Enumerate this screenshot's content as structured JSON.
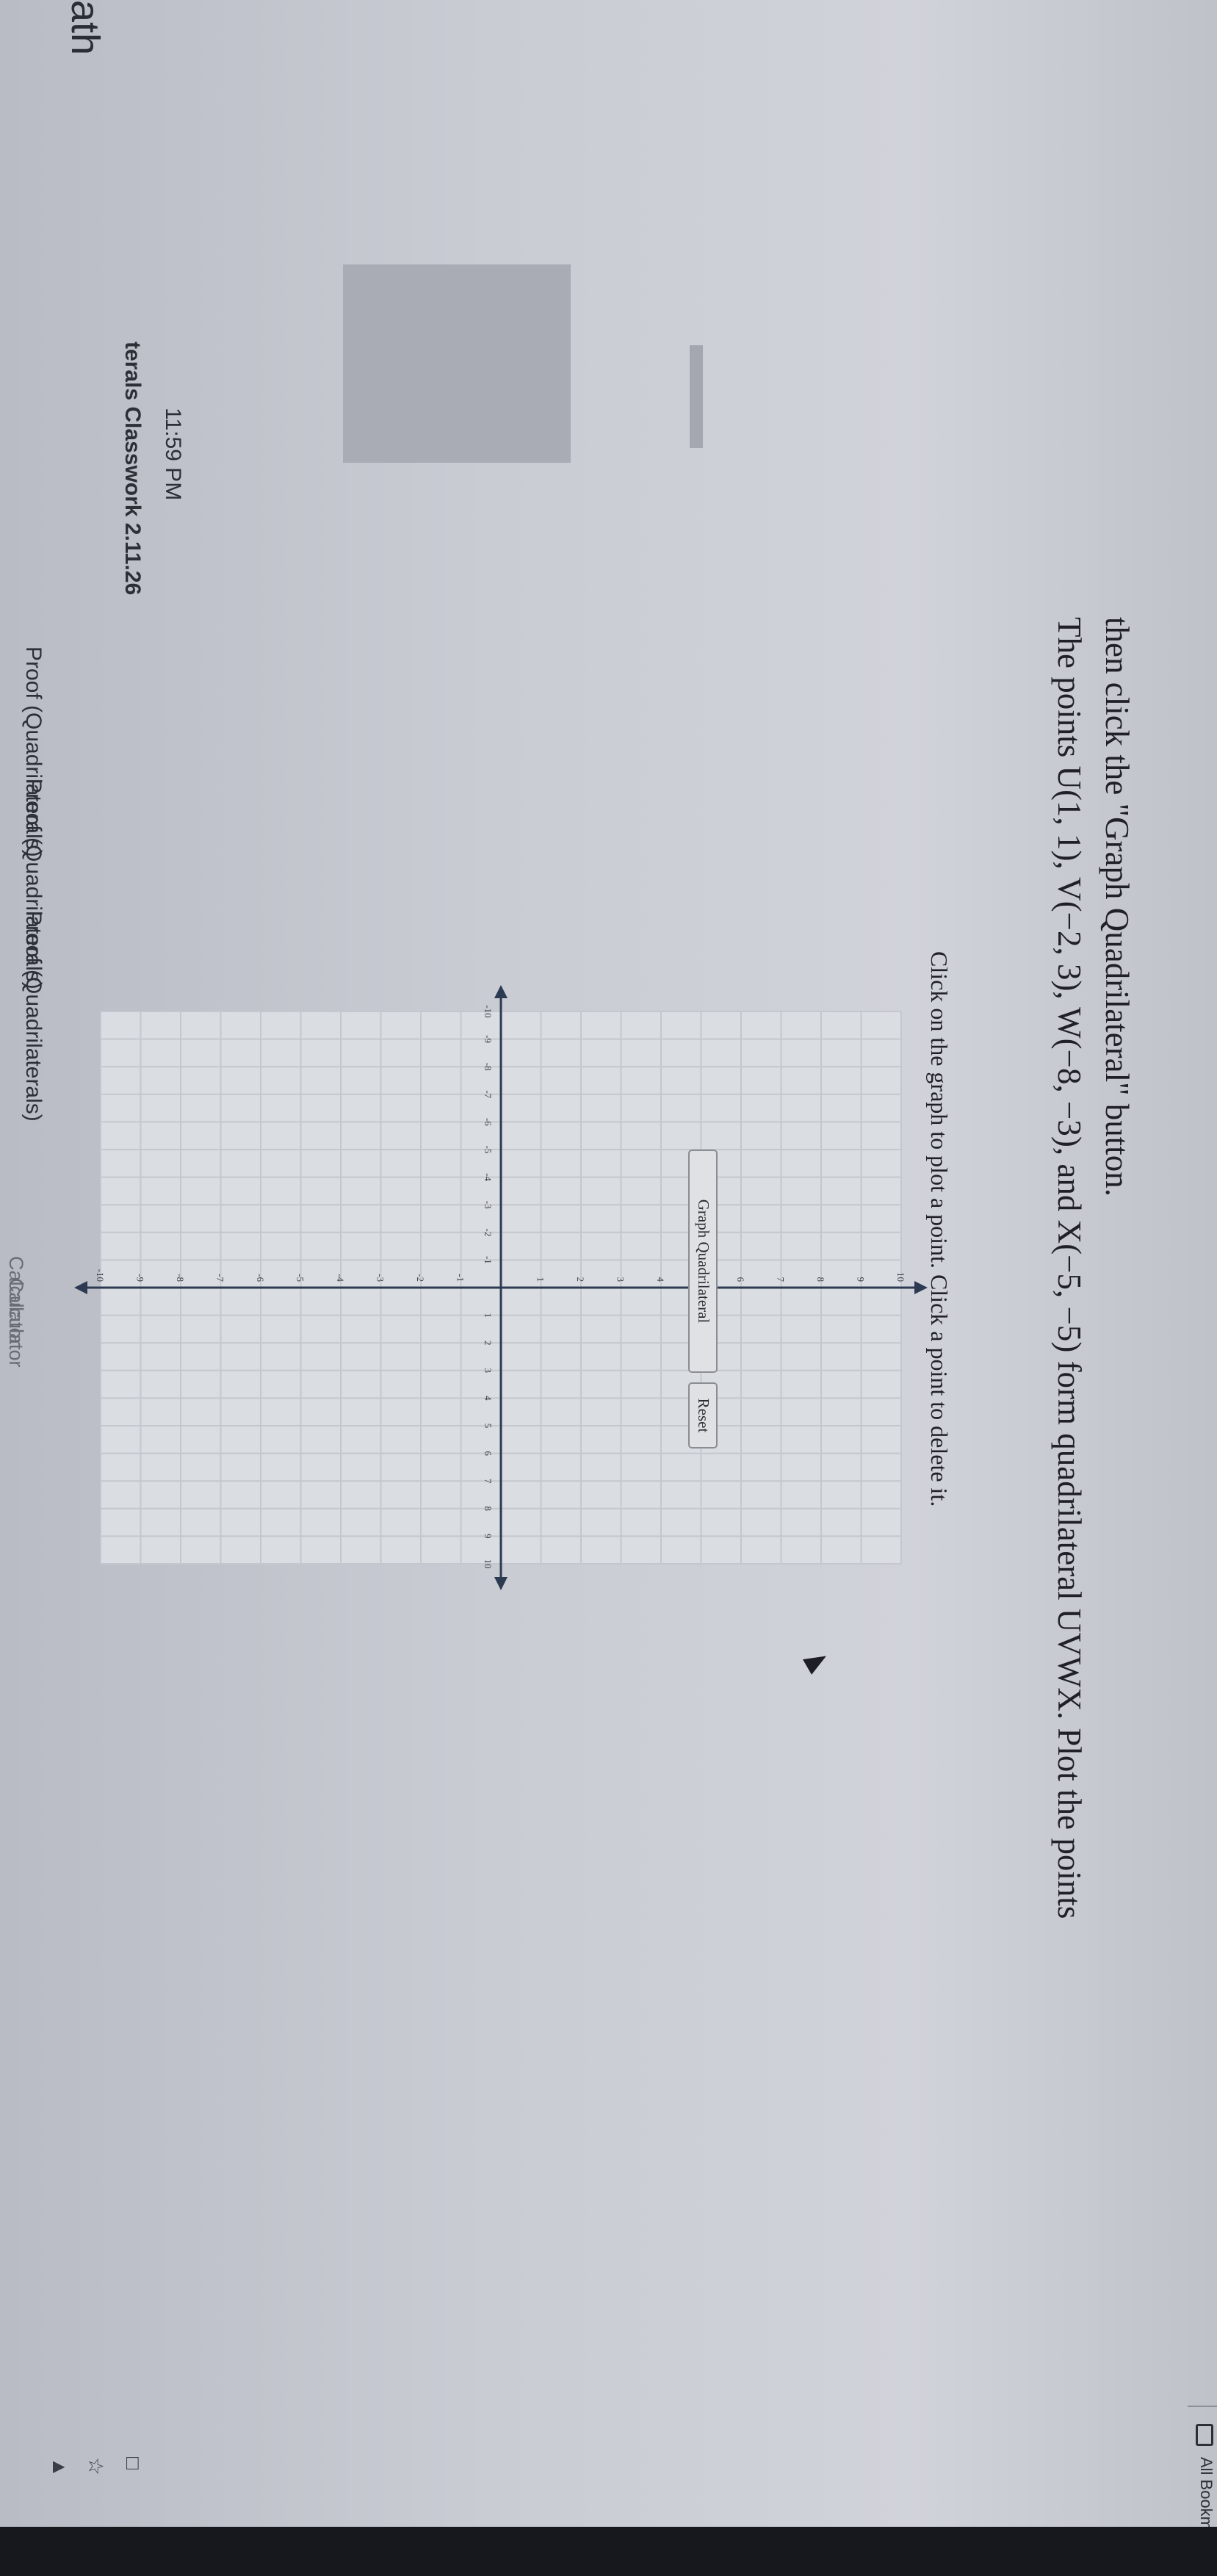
{
  "app": {
    "header": "ath"
  },
  "sidebar": {
    "assignment_title": "terals Classwork 2.11.26",
    "due_time": "11:59 PM",
    "items": [
      {
        "label": "Proof (Quadrilaterals)"
      },
      {
        "label": "Proof (Quadrilaterals)"
      },
      {
        "label": "Proof (Quadrilaterals)"
      }
    ],
    "tools": [
      {
        "label": "Calculator"
      },
      {
        "label": "Calculator"
      }
    ]
  },
  "browser": {
    "bookmarks_label": "All Bookmar"
  },
  "problem": {
    "line1": "The points U(1, 1), V(−2, 3), W(−8, −3), and X(−5, −5) form quadrilateral UVWX. Plot the points",
    "line2": "then click the \"Graph Quadrilateral\" button.",
    "instructions": "Click on the graph to plot a point. Click a point to delete it."
  },
  "graph": {
    "xlim": [
      -10,
      10
    ],
    "ylim": [
      -10,
      10
    ],
    "grid": true,
    "x_ticks": [
      -10,
      -9,
      -8,
      -7,
      -6,
      -5,
      -4,
      -3,
      -2,
      -1,
      1,
      2,
      3,
      4,
      5,
      6,
      7,
      8,
      9,
      10
    ],
    "y_ticks": [
      -10,
      -9,
      -8,
      -7,
      -6,
      -5,
      -4,
      -3,
      -2,
      -1,
      1,
      2,
      3,
      4,
      5,
      6,
      7,
      8,
      9,
      10
    ],
    "points": []
  },
  "buttons": {
    "graph_quadrilateral": "Graph Quadrilateral",
    "reset": "Reset"
  },
  "colors": {
    "grid": "#c4c7cd",
    "axis": "#2c3a52",
    "page_bg": "#c9ccd3"
  }
}
